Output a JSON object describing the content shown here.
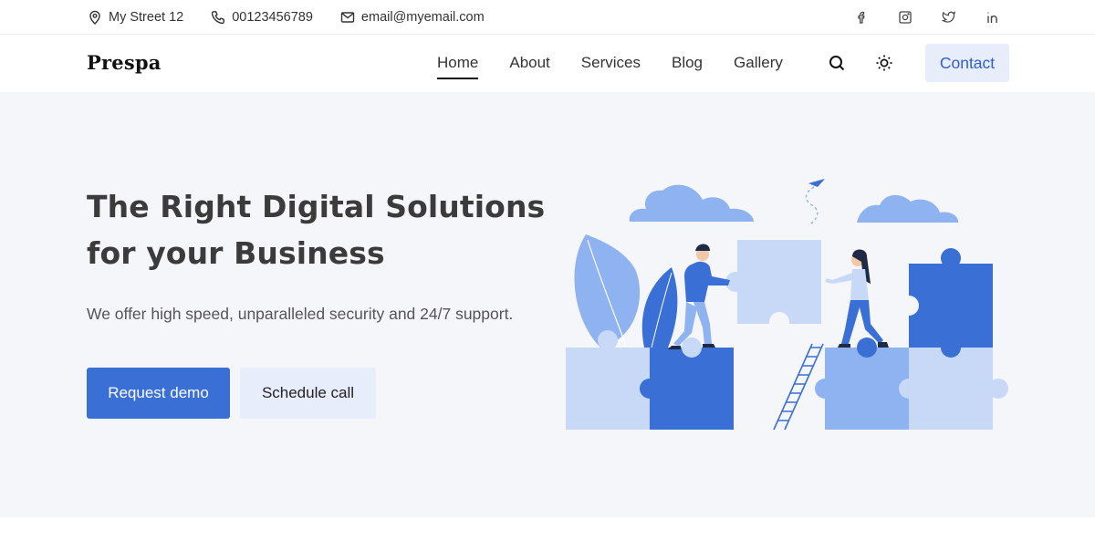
{
  "topbar": {
    "address": "My Street 12",
    "phone": "00123456789",
    "email": "email@myemail.com",
    "social_icons": [
      "facebook-icon",
      "instagram-icon",
      "twitter-icon",
      "linkedin-icon"
    ]
  },
  "nav": {
    "logo": "Prespa",
    "items": [
      {
        "label": "Home",
        "active": true
      },
      {
        "label": "About"
      },
      {
        "label": "Services"
      },
      {
        "label": "Blog"
      },
      {
        "label": "Gallery"
      }
    ],
    "search_icon": "search-icon",
    "theme_icon": "sun-icon",
    "contact_label": "Contact"
  },
  "hero": {
    "title_line1": "The Right Digital Solutions",
    "title_line2": "for your Business",
    "subtitle": "We offer high speed, unparalleled security and 24/7 support.",
    "primary_button": "Request demo",
    "secondary_button": "Schedule call"
  },
  "colors": {
    "accent": "#3a6fd6",
    "accent_light": "#e8edfc",
    "hero_background": "#f5f6fa",
    "puzzle_dark": "#3a6fd6",
    "puzzle_mid": "#8fb2f0",
    "puzzle_light": "#c7d9f7"
  }
}
